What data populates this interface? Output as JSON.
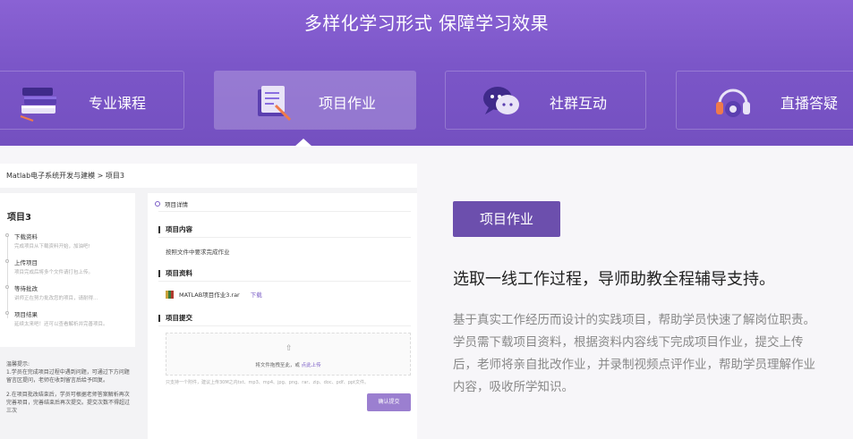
{
  "hero": {
    "title": "多样化学习形式 保障学习效果"
  },
  "tabs": [
    {
      "label": "专业课程",
      "icon": "books-icon",
      "active": false
    },
    {
      "label": "项目作业",
      "icon": "assignment-icon",
      "active": true
    },
    {
      "label": "社群互动",
      "icon": "chat-bubbles-icon",
      "active": false
    },
    {
      "label": "直播答疑",
      "icon": "headset-icon",
      "active": false
    }
  ],
  "screenshot": {
    "breadcrumb": "Matlab电子系统开发与建模 > 项目3",
    "left": {
      "title": "项目3",
      "steps": [
        {
          "label": "下载资料",
          "desc": "完成项目从下载资料开始，加油吧!"
        },
        {
          "label": "上传项目",
          "desc": "项目完成后将多个文件请打包上传。"
        },
        {
          "label": "等待批改",
          "desc": "讲师正在努力批改您的项目，请耐得..."
        },
        {
          "label": "项目结果",
          "desc": "延续太来吧！还可以查看解析并完善项目。"
        }
      ],
      "tips_title": "温馨提示:",
      "tips": [
        "1.学员在完成项目过程中遇到问题，可通过下方问题留言区提问，老师在收到留言后给予回复。",
        "2.在项目批改结束后，学员可根据老师答案解析再次完善项目，完善结束后再次提交。提交次数不得超过三次"
      ]
    },
    "right": {
      "header": "项目详情",
      "content_title": "项目内容",
      "content_text": "按照文件中要求完成作业",
      "materials_title": "项目资料",
      "file_name": "MATLAB项目作业3.rar",
      "download_label": "下载",
      "submit_title": "项目提交",
      "upload_text": "将文件拖拽至此，或",
      "upload_link": "点此上传",
      "upload_note": "只支持一个附件，建议上传30M之内txt、mp3、mp4、jpg、png、rar、zip、doc、pdf、ppt文件。",
      "confirm_label": "确认提交"
    }
  },
  "feature": {
    "badge": "项目作业",
    "title": "选取一线工作过程，导师助教全程辅导支持。",
    "body": "基于真实工作经历而设计的实践项目，帮助学员快速了解岗位职责。学员需下载项目资料，根据资料内容线下完成项目作业，提交上传后，老师将亲自批改作业，并录制视频点评作业，帮助学员理解作业内容，吸收所学知识。"
  }
}
